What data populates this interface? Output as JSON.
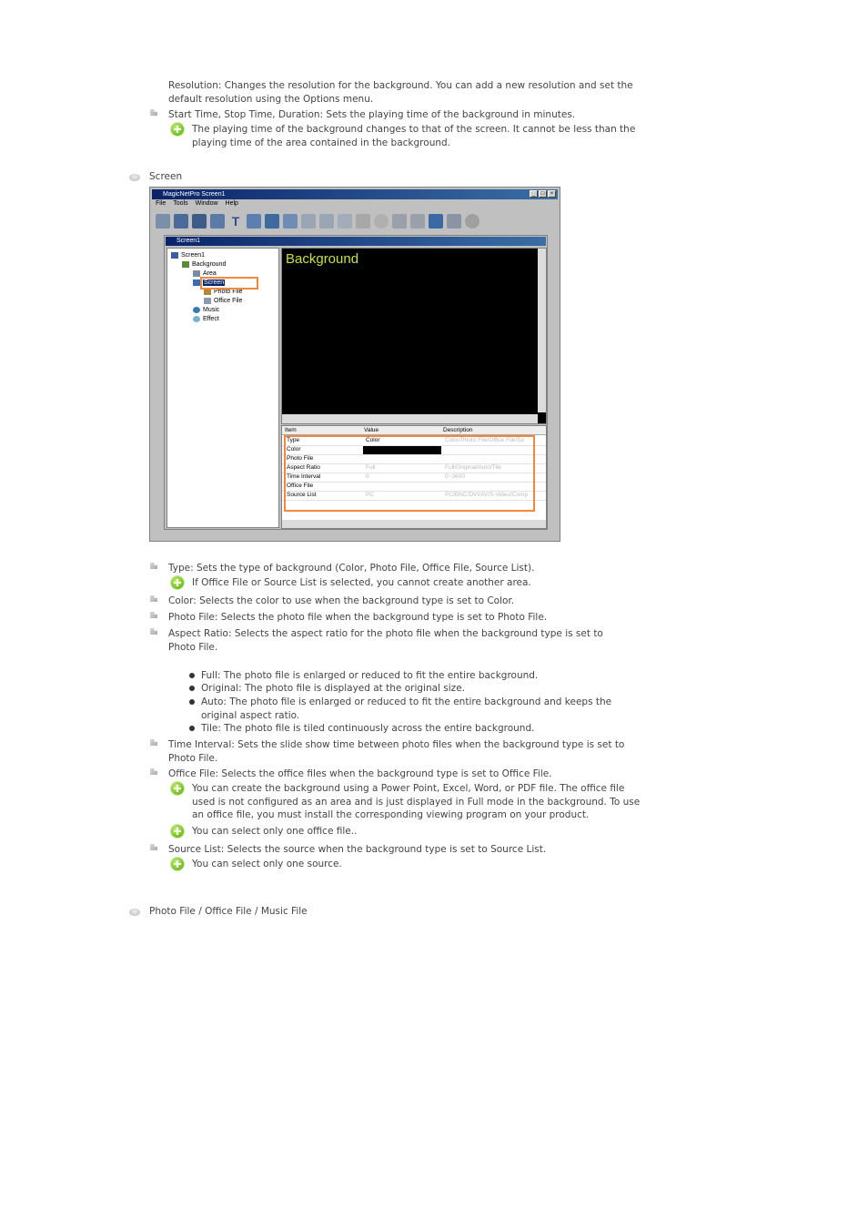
{
  "intro": {
    "resolution": "Resolution: Changes the resolution for the background. You can add a new resolution and set the default resolution using the Options menu.",
    "start_time": "Start Time, Stop Time, Duration: Sets the playing time of the background in minutes.",
    "start_time_note": "The playing time of the background changes to that of the screen. It cannot be less than the playing time of the area contained in the background."
  },
  "section_screen": {
    "title": "Screen"
  },
  "screenshot": {
    "app_title": "MagicNetPro Screen1",
    "menu": [
      "File",
      "Tools",
      "Window",
      "Help"
    ],
    "inner_title": "Screen1",
    "tree": [
      "Screen1",
      "Background",
      "Area",
      "Screen",
      "Photo File",
      "Office File",
      "Music",
      "Effect"
    ],
    "preview_label": "Background",
    "grid_headers": [
      "Item",
      "Value",
      "Description"
    ],
    "grid_rows": [
      {
        "item": "Type",
        "value": "Color",
        "desc": "Color/Photo File/Office File/So"
      },
      {
        "item": "Color",
        "value": "",
        "desc": ""
      },
      {
        "item": "Photo File",
        "value": "",
        "desc": ""
      },
      {
        "item": "Aspect Ratio",
        "value": "Full",
        "desc": "Full/Original/Auto/Tile"
      },
      {
        "item": "Time Interval",
        "value": "0",
        "desc": "0~3600"
      },
      {
        "item": "Office File",
        "value": "",
        "desc": ""
      },
      {
        "item": "Source List",
        "value": "PC",
        "desc": "PC/BNC/DVI/AV/S-Video/Comp"
      }
    ],
    "colors": {
      "accent_orange": "#f2883b",
      "preview_text": "#c8e23c",
      "color_swatch": "#000000"
    }
  },
  "items": {
    "type": "Type: Sets the type of background (Color, Photo File, Office File, Source List).",
    "type_note": "If Office File or Source List is selected, you cannot create another area.",
    "color": "Color: Selects the color to use when the background type is set to Color.",
    "photo_file": "Photo File: Selects the photo file when the background type is set to Photo File.",
    "aspect_ratio": "Aspect Ratio: Selects the aspect ratio for the photo file when the background type is set to Photo File.",
    "aspect_options": [
      "Full: The photo file is enlarged or reduced to fit the entire background.",
      "Original: The photo file is displayed at the original size.",
      "Auto: The photo file is enlarged or reduced to fit the entire background and keeps the original aspect ratio.",
      "Tile: The photo file is tiled continuously across the entire background."
    ],
    "time_interval": "Time Interval: Sets the slide show time between photo files when the background type is set to Photo File.",
    "office_file": "Office File: Selects the office files when the background type is set to Office File.",
    "office_note_1": "You can create the background using a Power Point, Excel, Word, or PDF file. The office file used is not configured as an area and is just displayed in Full mode in the background. To use an office file, you must install the corresponding viewing program on your product.",
    "office_note_2": "You can select only one office file..",
    "source_list": "Source List: Selects the source when the background type is set to Source List.",
    "source_note": "You can select only one source."
  },
  "section_photo": {
    "title": "Photo File / Office File / Music File"
  }
}
